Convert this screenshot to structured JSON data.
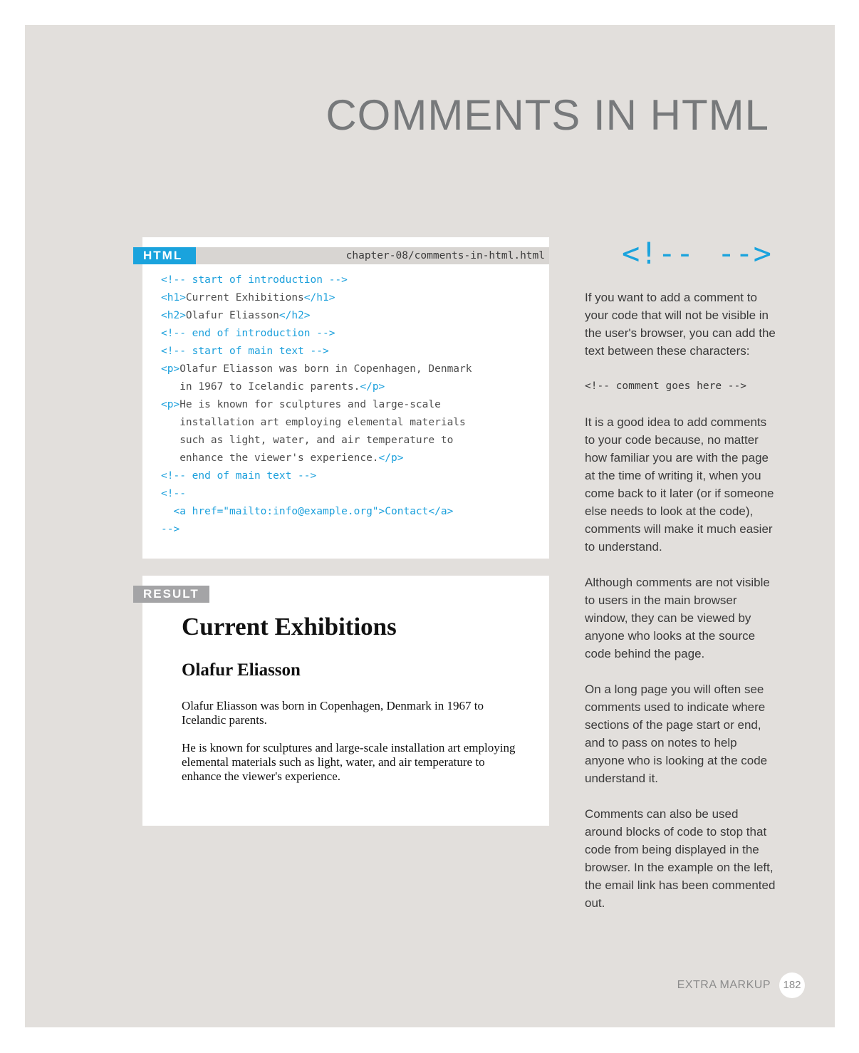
{
  "page": {
    "title": "COMMENTS IN HTML",
    "footer_label": "EXTRA MARKUP",
    "page_number": "182"
  },
  "code_panel": {
    "tab_label": "HTML",
    "filename": "chapter-08/comments-in-html.html",
    "lines": [
      [
        {
          "t": "<!-- start of introduction -->",
          "k": "cm"
        }
      ],
      [
        {
          "t": "<h1>",
          "k": "tg"
        },
        {
          "t": "Current Exhibitions",
          "k": "tx"
        },
        {
          "t": "</h1>",
          "k": "tg"
        }
      ],
      [
        {
          "t": "<h2>",
          "k": "tg"
        },
        {
          "t": "Olafur Eliasson",
          "k": "tx"
        },
        {
          "t": "</h2>",
          "k": "tg"
        }
      ],
      [
        {
          "t": "<!-- end of introduction -->",
          "k": "cm"
        }
      ],
      [
        {
          "t": "<!-- start of main text -->",
          "k": "cm"
        }
      ],
      [
        {
          "t": "<p>",
          "k": "tg"
        },
        {
          "t": "Olafur Eliasson was born in Copenhagen, Denmark",
          "k": "tx"
        }
      ],
      [
        {
          "t": "   in 1967 to Icelandic parents.",
          "k": "tx"
        },
        {
          "t": "</p>",
          "k": "tg"
        }
      ],
      [
        {
          "t": "<p>",
          "k": "tg"
        },
        {
          "t": "He is known for sculptures and large-scale",
          "k": "tx"
        }
      ],
      [
        {
          "t": "   installation art employing elemental materials",
          "k": "tx"
        }
      ],
      [
        {
          "t": "   such as light, water, and air temperature to",
          "k": "tx"
        }
      ],
      [
        {
          "t": "   enhance the viewer's experience.",
          "k": "tx"
        },
        {
          "t": "</p>",
          "k": "tg"
        }
      ],
      [
        {
          "t": "<!-- end of main text -->",
          "k": "cm"
        }
      ],
      [
        {
          "t": "<!--",
          "k": "cm"
        }
      ],
      [
        {
          "t": "  <a href=\"mailto:info@example.org\">Contact</a>",
          "k": "cm"
        }
      ],
      [
        {
          "t": "-->",
          "k": "cm"
        }
      ]
    ]
  },
  "result_panel": {
    "tab_label": "RESULT",
    "heading1": "Current Exhibitions",
    "heading2": "Olafur Eliasson",
    "paragraph1": "Olafur Eliasson was born in Copenhagen, Denmark in 1967 to Icelandic parents.",
    "paragraph2": "He is known for sculptures and large-scale installation art employing elemental materials such as light, water, and air temperature to enhance the viewer's experience."
  },
  "sidebar": {
    "symbol_open": "<!--",
    "symbol_close": "-->",
    "symbol_color": "#1aa3dd",
    "intro": "If you want to add a comment to your code that will not be visible in the user's browser, you can add the text between these characters:",
    "example_code": "<!-- comment goes here -->",
    "para2": "It is a good idea to add comments to your code because, no matter how familiar you are with the page at the time of writing it, when you come back to it later (or if someone else needs to look at the code), comments will make it much easier to understand.",
    "para3": "Although comments are not visible to users in the main browser window, they can be viewed by anyone who looks at the source code behind the page.",
    "para4": "On a long page you will often see comments used to indicate where sections of the page start or end, and to pass on notes to help anyone who is looking at the code understand it.",
    "para5": "Comments can also be used around blocks of code to stop that code from being displayed in the browser. In the example on the left, the email link has been commented out."
  }
}
